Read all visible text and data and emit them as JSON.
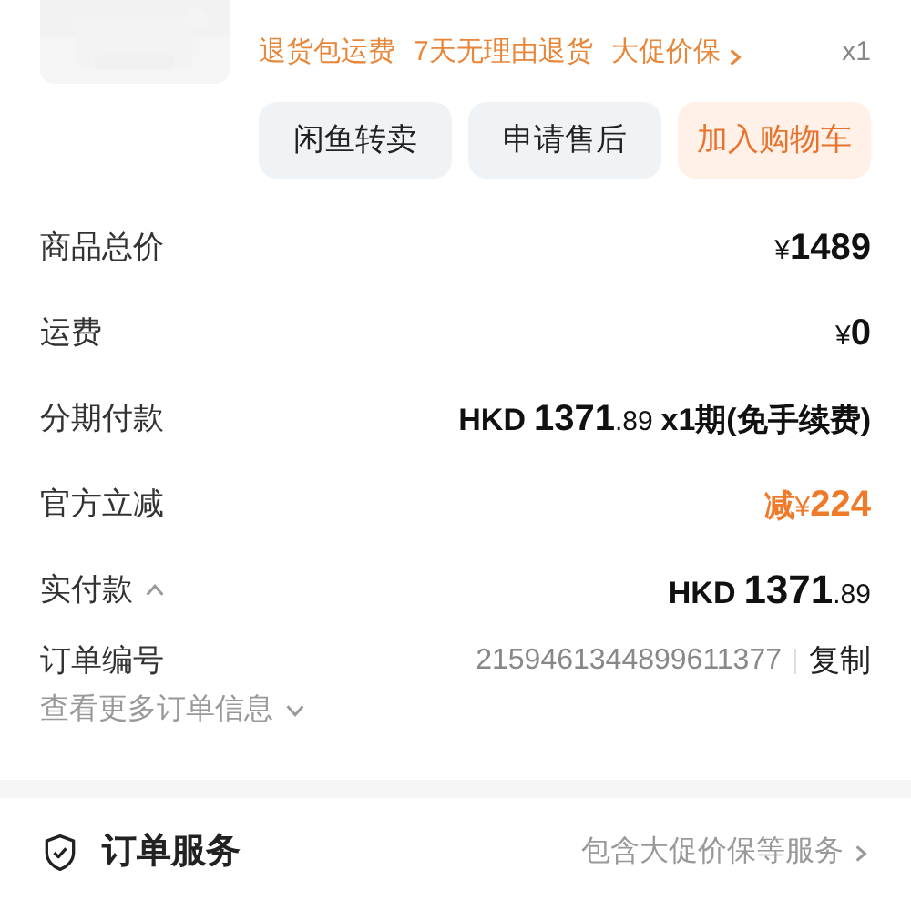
{
  "product": {
    "kind": "picture",
    "tags": [
      "退货包运费",
      "7天无理由退货",
      "大促价保"
    ],
    "quantity": "x1"
  },
  "actions": [
    {
      "label": "闲鱼转卖",
      "kind": "plain"
    },
    {
      "label": "申请售后",
      "kind": "plain"
    },
    {
      "label": "加入购物车",
      "kind": "primary"
    }
  ],
  "summary": [
    {
      "label": "商品总价",
      "discount": false,
      "emphasized": false,
      "currency": "¥",
      "integer": "1489"
    },
    {
      "label": "运费",
      "discount": false,
      "emphasized": false,
      "currency": "¥",
      "integer": "0"
    },
    {
      "label": "分期付款",
      "discount": false,
      "emphasized": false,
      "currency": "HKD",
      "integer": "1371",
      "decimal": ".89",
      "suffix": "x1期(免手续费)"
    },
    {
      "label": "官方立减",
      "discount": true,
      "emphasized": false,
      "prefix": "减",
      "currency": "¥",
      "integer": "224"
    },
    {
      "label": "实付款",
      "discount": false,
      "emphasized": true,
      "expanded": true,
      "currency": "HKD",
      "integer": "1371",
      "decimal": ".89"
    }
  ],
  "order": {
    "label": "订单编号",
    "number": "2159461344899611377",
    "copy": "复制",
    "more": "查看更多订单信息",
    "more_expanded": false
  },
  "service": {
    "title": "订单服务",
    "link": "包含大促价保等服务"
  }
}
